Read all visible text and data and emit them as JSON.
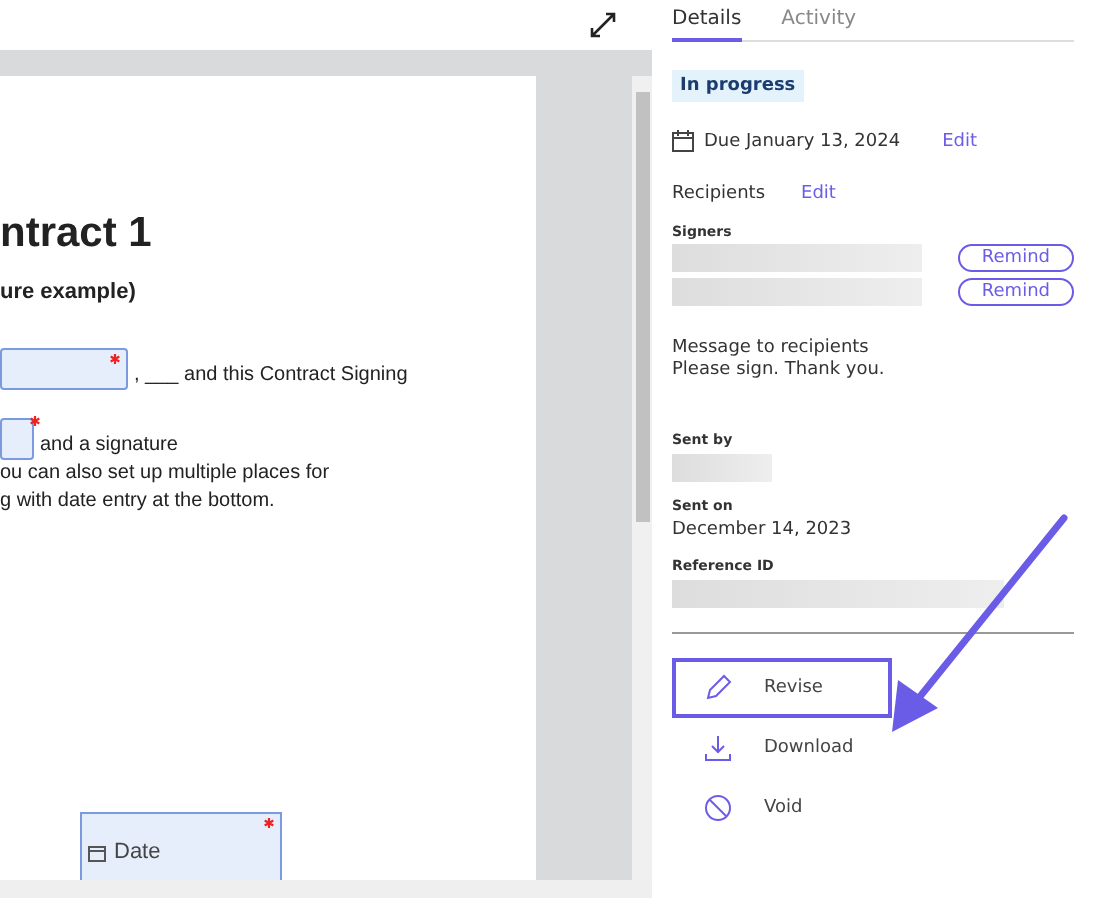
{
  "document": {
    "title": "ntract 1",
    "subtitle": "ure example)",
    "line_1": ", ___ and this Contract Signing",
    "line_2": "and a signature",
    "line_3": "ou can also set up multiple places for",
    "line_4": "g with date entry at the bottom.",
    "date_field": {
      "placeholder": "Date"
    }
  },
  "tabs": [
    {
      "label": "Details",
      "selected": true
    },
    {
      "label": "Activity",
      "selected": false
    }
  ],
  "status": "In progress",
  "due": {
    "text": "Due January 13, 2024",
    "action": "Edit"
  },
  "recipients": {
    "label": "Recipients",
    "action": "Edit",
    "signers_label": "Signers",
    "signers": [
      {
        "action": "Remind"
      },
      {
        "action": "Remind"
      }
    ]
  },
  "message": {
    "label": "Message to recipients",
    "text": "Please sign. Thank you."
  },
  "sent_by": {
    "label": "Sent by"
  },
  "sent_on": {
    "label": "Sent on",
    "value": "December 14, 2023"
  },
  "reference_id": {
    "label": "Reference ID"
  },
  "actions": [
    {
      "kind": "revise",
      "label": "Revise",
      "highlighted": true
    },
    {
      "kind": "download",
      "label": "Download",
      "highlighted": false
    },
    {
      "kind": "void",
      "label": "Void",
      "highlighted": false
    }
  ]
}
